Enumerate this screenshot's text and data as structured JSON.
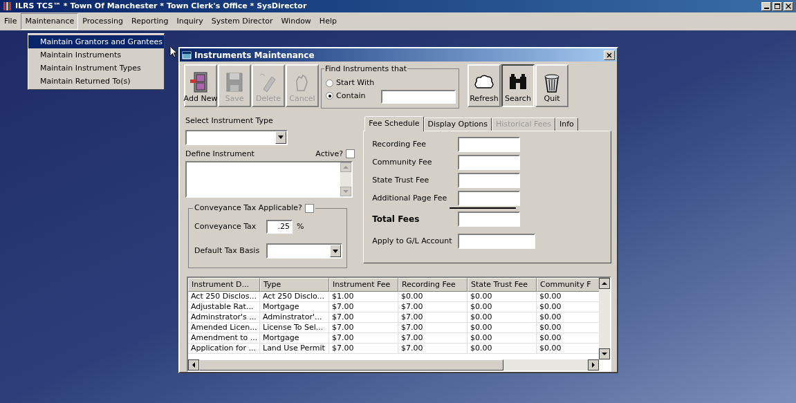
{
  "window": {
    "title": "ILRS TCS™ * Town Of Manchester * Town Clerk's Office * SysDirector"
  },
  "menu_bar": [
    {
      "label": "File",
      "selected": false
    },
    {
      "label": "Maintenance",
      "selected": true
    },
    {
      "label": "Processing",
      "selected": false
    },
    {
      "label": "Reporting",
      "selected": false
    },
    {
      "label": "Inquiry",
      "selected": false
    },
    {
      "label": "System Director",
      "selected": false
    },
    {
      "label": "Window",
      "selected": false
    },
    {
      "label": "Help",
      "selected": false
    }
  ],
  "menu_dropdown": [
    {
      "label": "Maintain Grantors and Grantees",
      "selected": true
    },
    {
      "label": "Maintain Instruments",
      "selected": false
    },
    {
      "label": "Maintain Instrument Types",
      "selected": false
    },
    {
      "label": "Maintain Returned To(s)",
      "selected": false
    }
  ],
  "dialog": {
    "title": "Instruments Maintenance",
    "toolbar_left": [
      {
        "kind": "add",
        "label": "Add New",
        "disabled": false
      },
      {
        "kind": "save",
        "label": "Save",
        "disabled": true
      },
      {
        "kind": "delete",
        "label": "Delete",
        "disabled": true
      },
      {
        "kind": "cancel",
        "label": "Cancel",
        "disabled": true
      }
    ],
    "find": {
      "title": "Find Instruments that",
      "options": [
        {
          "label": "Start With",
          "selected": false
        },
        {
          "label": "Contain",
          "selected": true
        }
      ]
    },
    "toolbar_right": [
      {
        "kind": "refresh",
        "label": "Refresh",
        "selected": false
      },
      {
        "kind": "search",
        "label": "Search",
        "selected": true
      },
      {
        "kind": "quit",
        "label": "Quit",
        "selected": false
      }
    ],
    "select_instrument_type": {
      "label": "Select Instrument Type"
    },
    "define_instrument": {
      "label": "Define Instrument"
    },
    "active": {
      "label": "Active?",
      "checked": false
    },
    "conveyance": {
      "label": "Conveyance Tax Applicable?",
      "checked": false,
      "tax_label": "Conveyance Tax",
      "tax_value": ".25",
      "tax_unit": "%",
      "basis_label": "Default Tax Basis"
    },
    "tabs": [
      {
        "label": "Fee Schedule",
        "selected": true,
        "disabled": false
      },
      {
        "label": "Display Options",
        "selected": false,
        "disabled": false
      },
      {
        "label": "Historical Fees",
        "selected": false,
        "disabled": true
      },
      {
        "label": "Info",
        "selected": false,
        "disabled": false
      }
    ],
    "fee_fields": [
      {
        "kind": "fee",
        "label": "Recording Fee"
      },
      {
        "kind": "fee",
        "label": "Community Fee"
      },
      {
        "kind": "fee",
        "label": "State Trust Fee"
      },
      {
        "kind": "last",
        "label": "Additional Page Fee"
      },
      {
        "kind": "total",
        "label": "Total Fees"
      },
      {
        "kind": "account",
        "label": "Apply to G/L Account"
      }
    ],
    "table": {
      "columns": [
        "Instrument D...",
        "Type",
        "Instrument Fee",
        "Recording Fee",
        "State Trust Fee",
        "Community F"
      ],
      "rows": [
        [
          "Act 250 Disclos...",
          "Act 250 Disclo...",
          "$1.00",
          "$0.00",
          "$0.00",
          "$0.00"
        ],
        [
          "Adjustable Rat...",
          "Mortgage",
          "$7.00",
          "$7.00",
          "$0.00",
          "$0.00"
        ],
        [
          "Adminstrator's ...",
          "Adminstrator'...",
          "$7.00",
          "$7.00",
          "$0.00",
          "$0.00"
        ],
        [
          "Amended Licen...",
          "License To Sel...",
          "$7.00",
          "$7.00",
          "$0.00",
          "$0.00"
        ],
        [
          "Amendment to ...",
          "Mortgage",
          "$7.00",
          "$7.00",
          "$0.00",
          "$0.00"
        ],
        [
          "Application for ...",
          "Land Use Permit",
          "$7.00",
          "$7.00",
          "$0.00",
          "$0.00"
        ]
      ]
    }
  }
}
